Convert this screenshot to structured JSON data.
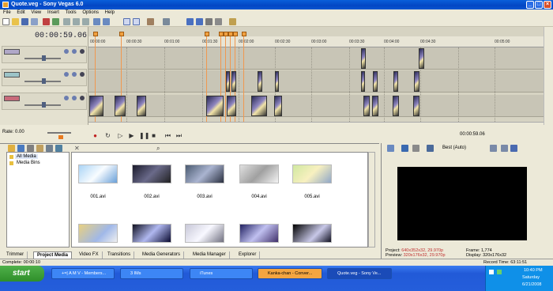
{
  "window": {
    "title": "Quote.veg - Sony Vegas 6.0"
  },
  "menu": [
    "File",
    "Edit",
    "View",
    "Insert",
    "Tools",
    "Options",
    "Help"
  ],
  "timeline": {
    "timecode": "00:00:59.06",
    "ruler_ticks": [
      "00:00:00",
      "00:00:30",
      "00:01:00",
      "00:01:30",
      "00:02:00",
      "00:02:30",
      "00:03:00",
      "00:03:30",
      "00:04:00",
      "00:04:30",
      "00:05:00"
    ],
    "track_numbers": [
      "1",
      "2",
      "3"
    ],
    "rate_label": "Rate: 0.00",
    "transport_timecode": "00:00:59.06"
  },
  "explorer": {
    "tree": [
      {
        "label": "All Media",
        "selected": true
      },
      {
        "label": "Media Bins",
        "selected": false
      }
    ],
    "media": [
      {
        "label": "001.avi"
      },
      {
        "label": "002.avi"
      },
      {
        "label": "003.avi"
      },
      {
        "label": "004.avi"
      },
      {
        "label": "005.avi"
      },
      {
        "label": ""
      },
      {
        "label": ""
      },
      {
        "label": ""
      },
      {
        "label": ""
      },
      {
        "label": ""
      }
    ],
    "tabs": [
      "Trimmer",
      "Project Media",
      "Video FX",
      "Transitions",
      "Media Generators",
      "Media Manager",
      "Explorer"
    ],
    "active_tab": "Project Media"
  },
  "preview": {
    "quality": "Best (Auto)",
    "project_label": "Project:",
    "project_value": "640x352x32, 29.970p",
    "preview_label": "Preview:",
    "preview_value": "320x176x32, 29.970p",
    "frame_label": "Frame:",
    "frame_value": "1,774",
    "display_label": "Display:",
    "display_value": "320x176x32"
  },
  "status": {
    "left": "Complete: 00:00:10",
    "right": "Record Time: 63:11:51"
  },
  "taskbar": {
    "start_label": "start",
    "tasks": [
      "+=| A M V - Members...",
      "3 IMs",
      "iTunes",
      "Kanka-chan - Conver...",
      "Quote.veg - Sony Ve..."
    ],
    "clock_time": "10:40 PM",
    "clock_day": "Saturday",
    "clock_date": "6/21/2008"
  },
  "colors": {
    "title_bar": "#0a5fd9",
    "preview_bg": "#000000",
    "marker": "#f0a040",
    "taskbar": "#245edb",
    "preview_value_text": "#c03030"
  }
}
